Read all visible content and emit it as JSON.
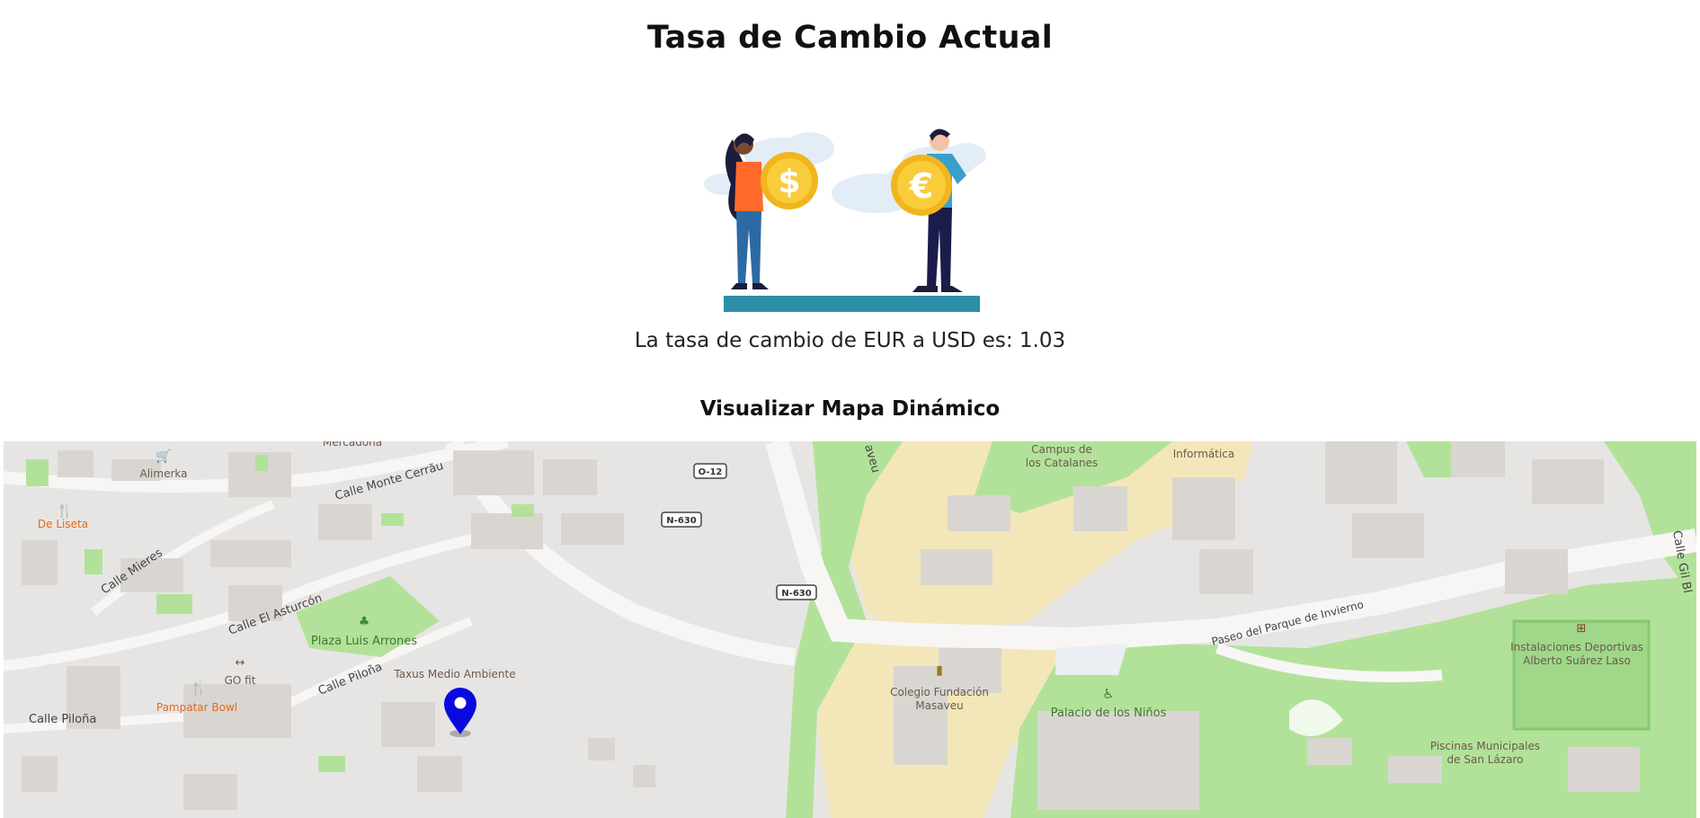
{
  "page": {
    "title": "Tasa de Cambio Actual",
    "rate_text": "La tasa de cambio de EUR a USD es: 1.03",
    "map_heading": "Visualizar Mapa Dinámico"
  },
  "illustration": {
    "coin_left_symbol": "$",
    "coin_right_symbol": "€"
  },
  "map": {
    "colors": {
      "base": "#e7e5e3",
      "park": "#b2e29a",
      "campus": "#f3e7b9",
      "building": "#d9d6d2",
      "pin": "#0a0adf"
    },
    "labels": {
      "mercadona": "Mercadona",
      "alimerka": "Alimerka",
      "de_liseta": "De Liseta",
      "calle_monte_cerrau": "Calle Monte Cerrău",
      "calle_mieres": "Calle Mieres",
      "calle_el_asturcon": "Calle El Asturcón",
      "plaza_luis_arrones": "Plaza Luis Arrones",
      "go_fit": "GO fit",
      "pampatar_bowl": "Pampatar Bowl",
      "calle_pilona_1": "Calle Piloña",
      "calle_pilona_2": "Calle Piloña",
      "taxus": "Taxus Medio Ambiente",
      "o12": "O-12",
      "n630_a": "N-630",
      "n630_b": "N-630",
      "masaveu_street": "aveu",
      "campus_line1": "Campus de",
      "campus_line2": "los Catalanes",
      "informatica": "Informática",
      "colegio_line1": "Colegio Fundación",
      "colegio_line2": "Masaveu",
      "palacio": "Palacio de los Niños",
      "paseo": "Paseo del Parque de Invierno",
      "instal_line1": "Instalaciones Deportivas",
      "instal_line2": "Alberto Suárez Laso",
      "piscinas_line1": "Piscinas Municipales",
      "piscinas_line2": "de San Lázaro",
      "calle_gil": "Calle Gil Bl"
    }
  }
}
